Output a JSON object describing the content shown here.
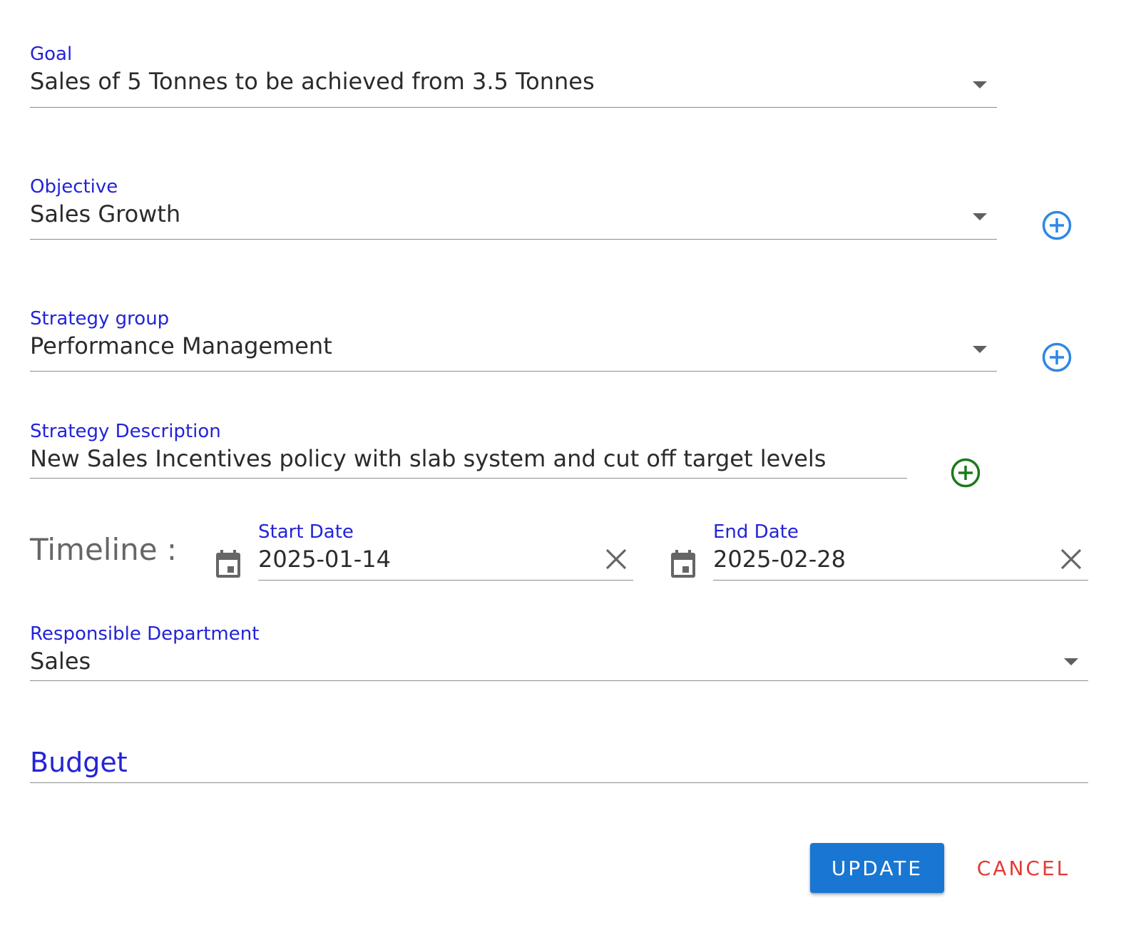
{
  "colors": {
    "label": "#2323d8",
    "value": "#2b2b2b",
    "add_blue": "#2f86e6",
    "add_green": "#1b7a1b",
    "primary_button": "#1976d2",
    "cancel_text": "#e53935"
  },
  "goal": {
    "label": "Goal",
    "value": "Sales of 5 Tonnes to be achieved from 3.5 Tonnes",
    "icon": "chevron-down-icon"
  },
  "objective": {
    "label": "Objective",
    "value": "Sales Growth",
    "icon": "chevron-down-icon",
    "add_icon": "add-circle-icon"
  },
  "strategy_group": {
    "label": "Strategy group",
    "value": "Performance Management",
    "icon": "chevron-down-icon",
    "add_icon": "add-circle-icon"
  },
  "strategy_description": {
    "label": "Strategy Description",
    "value": "New Sales Incentives policy with slab system and cut off target levels",
    "add_icon": "add-circle-icon"
  },
  "timeline": {
    "label": "Timeline :",
    "start": {
      "label": "Start Date",
      "value": "2025-01-14",
      "icon": "calendar-icon",
      "clear_icon": "close-icon"
    },
    "end": {
      "label": "End Date",
      "value": "2025-02-28",
      "icon": "calendar-icon",
      "clear_icon": "close-icon"
    }
  },
  "responsible_department": {
    "label": "Responsible Department",
    "value": "Sales",
    "icon": "chevron-down-icon"
  },
  "budget": {
    "label": "Budget"
  },
  "actions": {
    "update_label": "UPDATE",
    "cancel_label": "CANCEL"
  }
}
